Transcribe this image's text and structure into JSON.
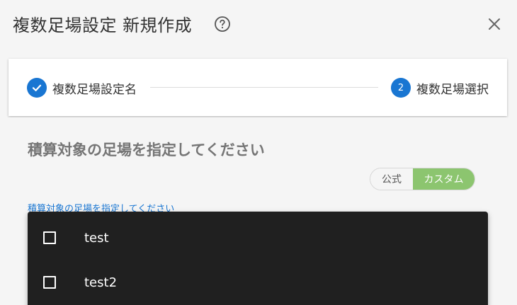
{
  "dialog": {
    "title": "複数足場設定 新規作成",
    "help_icon": "help-circle-icon",
    "close_icon": "close-icon"
  },
  "stepper": {
    "steps": [
      {
        "label": "複数足場設定名",
        "status": "completed",
        "icon": "check-circle-icon"
      },
      {
        "number": "2",
        "label": "複数足場選択",
        "status": "active"
      }
    ]
  },
  "content": {
    "title": "積算対象の足場を指定してください",
    "toggle": {
      "options": [
        "公式",
        "カスタム"
      ],
      "selected": "カスタム"
    },
    "field_label": "積算対象の足場を指定してください"
  },
  "dropdown": {
    "options": [
      {
        "label": "test",
        "checked": false
      },
      {
        "label": "test2",
        "checked": false
      }
    ]
  },
  "colors": {
    "primary": "#1976d2",
    "toggle_active": "#8cc56f",
    "dropdown_bg": "#202020"
  }
}
